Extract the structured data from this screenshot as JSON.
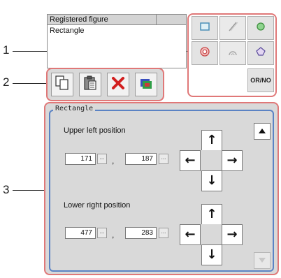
{
  "callouts": [
    "1",
    "2",
    "3"
  ],
  "registered": {
    "header": "Registered figure",
    "rows": [
      "Rectangle"
    ]
  },
  "shape_buttons": {
    "icons": [
      "rectangle-icon",
      "line-icon",
      "circle-icon",
      "ring-icon",
      "arc-icon",
      "polygon-icon"
    ],
    "or_not_label": "OR/NO"
  },
  "toolbar": {
    "icons": [
      "copy-icon",
      "paste-icon",
      "delete-icon",
      "color-icon"
    ]
  },
  "editor": {
    "legend": "Rectangle",
    "upper_left": {
      "label": "Upper left position",
      "x": "171",
      "y": "187"
    },
    "lower_right": {
      "label": "Lower right position",
      "x": "477",
      "y": "283"
    },
    "comma": ",",
    "dots": "...",
    "arrows": {
      "up": "↑",
      "down": "↓",
      "left": "←",
      "right": "→"
    }
  },
  "colors": {
    "highlight": "#e07878",
    "fieldset_border": "#5b83c4",
    "panel_bg": "#d9d9d9"
  }
}
